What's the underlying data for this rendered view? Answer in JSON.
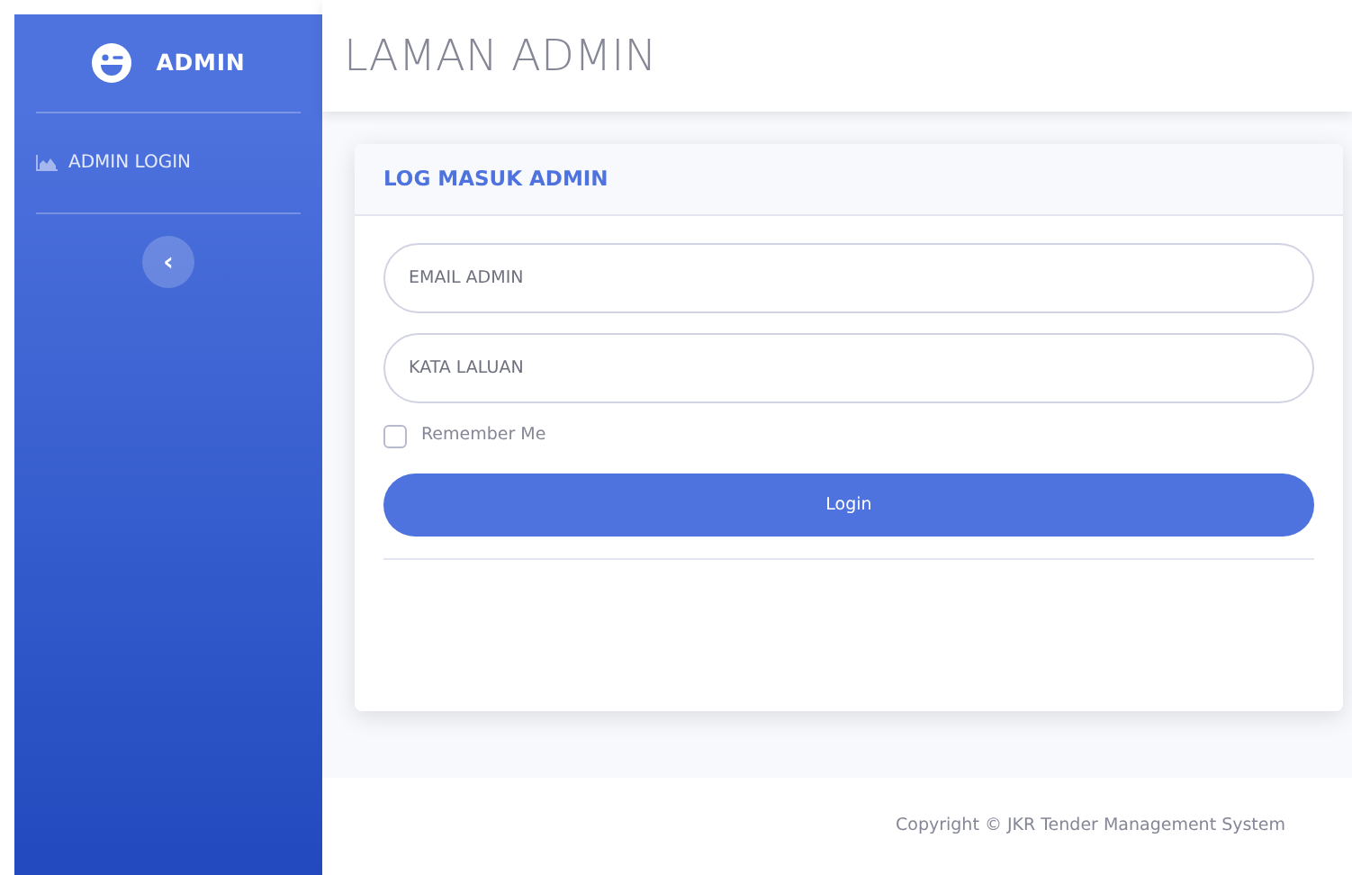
{
  "sidebar": {
    "brand": "ADMIN",
    "items": [
      {
        "label": "ADMIN LOGIN",
        "selected": false
      }
    ],
    "toggle": "‹"
  },
  "page_title": "LAMAN ADMIN",
  "card": {
    "title": "LOG MASUK ADMIN",
    "fields": [
      {
        "placeholder": "EMAIL ADMIN"
      },
      {
        "placeholder": "KATA LALUAN"
      }
    ],
    "remember": {
      "label": "Remember Me",
      "checked": false
    },
    "button": "Login"
  },
  "footer": "Copyright © JKR Tender Management System"
}
